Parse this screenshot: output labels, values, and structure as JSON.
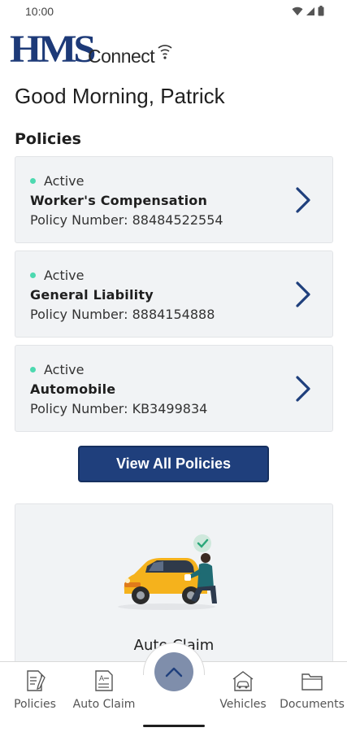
{
  "status_bar": {
    "time": "10:00"
  },
  "logo": {
    "brand": "HMS",
    "product": "Connect"
  },
  "greeting": "Good Morning, Patrick",
  "section_title": "Policies",
  "policies": [
    {
      "status": "Active",
      "name": "Worker's Compensation",
      "number": "Policy Number: 88484522554"
    },
    {
      "status": "Active",
      "name": "General Liability",
      "number": "Policy Number: 8884154888"
    },
    {
      "status": "Active",
      "name": "Automobile",
      "number": "Policy Number: KB3499834"
    }
  ],
  "view_all_label": "View All Policies",
  "claim_card": {
    "label": "Auto Claim"
  },
  "bottom_nav": {
    "items": [
      {
        "label": "Policies",
        "icon": "policies-icon"
      },
      {
        "label": "Auto Claim",
        "icon": "auto-claim-icon"
      },
      {
        "label": "Vehicles",
        "icon": "vehicles-icon"
      },
      {
        "label": "Documents",
        "icon": "documents-icon"
      }
    ],
    "fab_icon": "chevron-up-icon"
  },
  "colors": {
    "brand": "#1d3a78",
    "button": "#1f3f7c",
    "active_dot": "#4dd9b0",
    "card_bg": "#f1f3f5",
    "fab": "#7f8eab"
  }
}
